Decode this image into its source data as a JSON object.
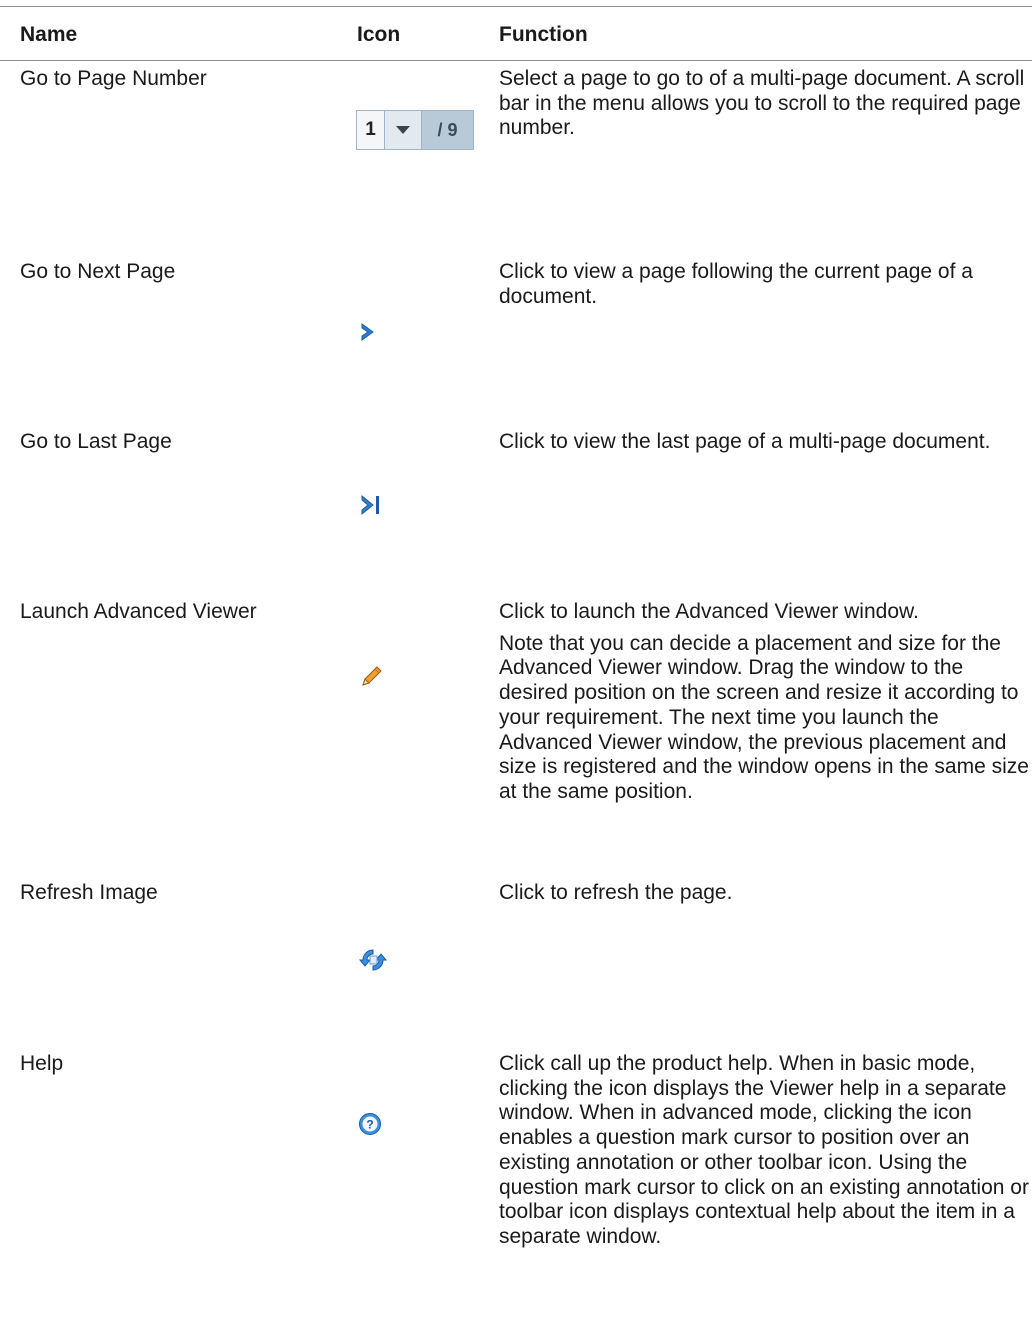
{
  "header": {
    "name": "Name",
    "icon": "Icon",
    "function": "Function"
  },
  "rows": [
    {
      "name": "Go to Page Number",
      "icon": "page-number-selector",
      "pager": {
        "current": "1",
        "total": "/ 9"
      },
      "function": [
        "Select a page to go to of a multi-page document. A scroll bar in the menu allows you to scroll to the required page number."
      ]
    },
    {
      "name": "Go to Next Page",
      "icon": "next-page-icon",
      "function": [
        "Click to view a page following the current page of a document."
      ]
    },
    {
      "name": "Go to Last Page",
      "icon": "last-page-icon",
      "function": [
        "Click to view the last page of a multi-page document."
      ]
    },
    {
      "name": "Launch Advanced Viewer",
      "icon": "pencil-icon",
      "function": [
        "Click to launch the Advanced Viewer window.",
        "Note that you can decide a placement and size for the Advanced Viewer window. Drag the window to the desired position on the screen and resize it according to your requirement. The next time you launch the Advanced Viewer window, the previous placement and size is registered and the window opens in the same size at the same position."
      ]
    },
    {
      "name": "Refresh Image",
      "icon": "refresh-icon",
      "function": [
        "Click to refresh the page."
      ]
    },
    {
      "name": "Help",
      "icon": "help-icon",
      "function": [
        "Click call up the product help. When in basic mode, clicking the icon displays the Viewer help in a separate window. When in advanced mode, clicking the icon enables a question mark cursor to position over an existing annotation or other toolbar icon. Using the question mark cursor to click on an existing annotation or toolbar icon displays contextual help about the item in a separate window."
      ]
    }
  ],
  "colors": {
    "rule": "#8c8c8c",
    "icon_blue": "#2f7fd1",
    "icon_blue_dark": "#1d5aa3",
    "pencil_orange": "#e0901c"
  }
}
